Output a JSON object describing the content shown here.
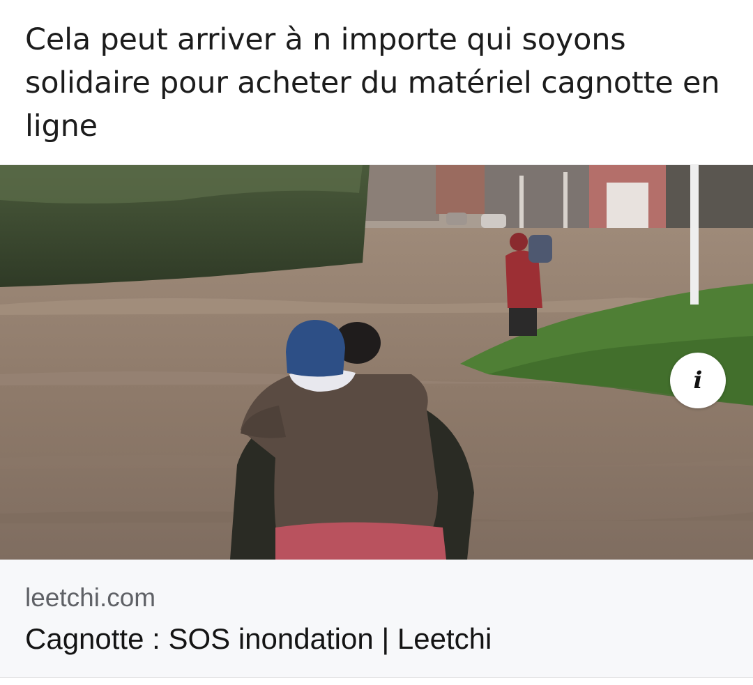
{
  "post": {
    "text": "Cela peut arriver à n importe qui soyons solidaire pour acheter du matériel cagnotte en ligne"
  },
  "link_preview": {
    "image_alt": "Personnes traversant une rue inondée",
    "domain": "leetchi.com",
    "title": "Cagnotte : SOS inondation | Leetchi",
    "info_icon": "info-icon",
    "info_glyph": "i"
  },
  "colors": {
    "text": "#1c1c1c",
    "domain_text": "#5f6166",
    "meta_background": "#f7f8fa",
    "floodwater": "#8d7a6b"
  }
}
